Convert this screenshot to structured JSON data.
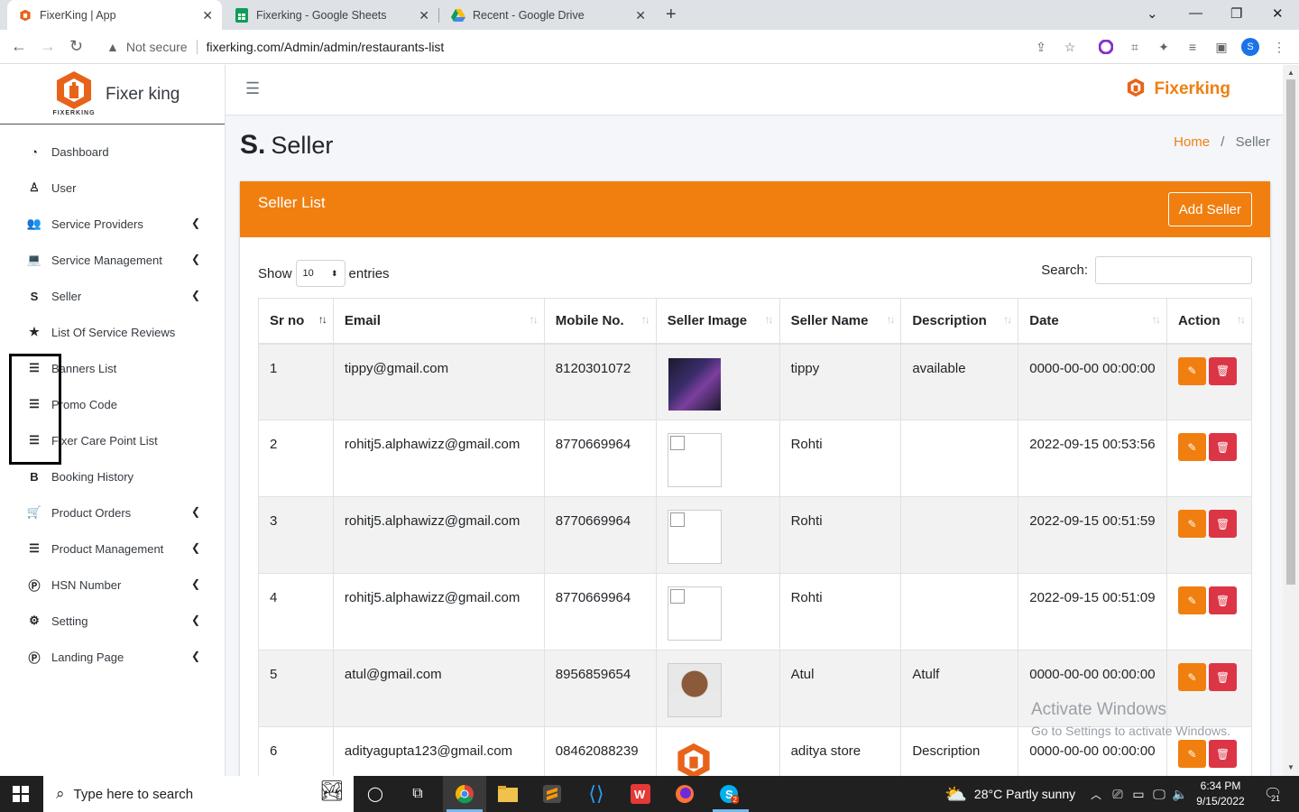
{
  "browser": {
    "tabs": [
      {
        "title": "FixerKing | App"
      },
      {
        "title": "Fixerking - Google Sheets"
      },
      {
        "title": "Recent - Google Drive"
      }
    ],
    "security": "Not secure",
    "url": "fixerking.com/Admin/admin/restaurants-list",
    "profile_initial": "S"
  },
  "sidebar": {
    "brand": "Fixer king",
    "logo_caption": "FIXERKING",
    "items": [
      {
        "label": "Dashboard",
        "icon": "dashboard-icon",
        "glyph": "◔",
        "has_sub": false
      },
      {
        "label": "User",
        "icon": "user-icon",
        "glyph": "♙",
        "has_sub": false
      },
      {
        "label": "Service Providers",
        "icon": "users-icon",
        "glyph": "👥",
        "has_sub": true
      },
      {
        "label": "Service Management",
        "icon": "laptop-icon",
        "glyph": "💻",
        "has_sub": true
      },
      {
        "label": "Seller",
        "icon": "seller-s-icon",
        "glyph": "S",
        "has_sub": true
      },
      {
        "label": "List Of Service Reviews",
        "icon": "star-icon",
        "glyph": "★",
        "has_sub": false
      },
      {
        "label": "Banners List",
        "icon": "list-icon",
        "glyph": "☰",
        "has_sub": false
      },
      {
        "label": "Promo Code",
        "icon": "list-icon",
        "glyph": "☰",
        "has_sub": false
      },
      {
        "label": "Fixer Care Point List",
        "icon": "list-icon",
        "glyph": "☰",
        "has_sub": false
      },
      {
        "label": "Booking History",
        "icon": "bold-b-icon",
        "glyph": "B",
        "has_sub": false
      },
      {
        "label": "Product Orders",
        "icon": "cart-icon",
        "glyph": "🛒",
        "has_sub": true
      },
      {
        "label": "Product Management",
        "icon": "list-icon",
        "glyph": "☰",
        "has_sub": true
      },
      {
        "label": "HSN Number",
        "icon": "p-circle-icon",
        "glyph": "Ⓟ",
        "has_sub": true
      },
      {
        "label": "Setting",
        "icon": "gears-icon",
        "glyph": "⚙",
        "has_sub": true
      },
      {
        "label": "Landing Page",
        "icon": "p-circle-icon",
        "glyph": "Ⓟ",
        "has_sub": true
      }
    ]
  },
  "topnav": {
    "brand": "Fixerking"
  },
  "page": {
    "icon_glyph": "S.",
    "title": "Seller",
    "breadcrumb_home": "Home",
    "breadcrumb_sep": "/",
    "breadcrumb_current": "Seller"
  },
  "card": {
    "title": "Seller List",
    "add_button": "Add Seller",
    "show_label": "Show",
    "entries_value": "10",
    "entries_label": "entries",
    "search_label": "Search:"
  },
  "table": {
    "columns": [
      "Sr no",
      "Email",
      "Mobile No.",
      "Seller Image",
      "Seller Name",
      "Description",
      "Date",
      "Action"
    ],
    "rows": [
      {
        "sr": "1",
        "email": "tippy@gmail.com",
        "mobile": "8120301072",
        "image": "phone",
        "name": "tippy",
        "desc": "available",
        "date": "0000-00-00 00:00:00"
      },
      {
        "sr": "2",
        "email": "rohitj5.alphawizz@gmail.com",
        "mobile": "8770669964",
        "image": "broken",
        "name": "Rohti",
        "desc": "",
        "date": "2022-09-15 00:53:56"
      },
      {
        "sr": "3",
        "email": "rohitj5.alphawizz@gmail.com",
        "mobile": "8770669964",
        "image": "broken",
        "name": "Rohti",
        "desc": "",
        "date": "2022-09-15 00:51:59"
      },
      {
        "sr": "4",
        "email": "rohitj5.alphawizz@gmail.com",
        "mobile": "8770669964",
        "image": "broken",
        "name": "Rohti",
        "desc": "",
        "date": "2022-09-15 00:51:09"
      },
      {
        "sr": "5",
        "email": "atul@gmail.com",
        "mobile": "8956859654",
        "image": "person",
        "name": "Atul",
        "desc": "Atulf",
        "date": "0000-00-00 00:00:00"
      },
      {
        "sr": "6",
        "email": "adityagupta123@gmail.com",
        "mobile": "08462088239",
        "image": "logo",
        "name": "aditya store",
        "desc": "Description",
        "date": "0000-00-00 00:00:00"
      }
    ]
  },
  "watermark": {
    "line1": "Activate Windows",
    "line2": "Go to Settings to activate Windows."
  },
  "taskbar": {
    "search_placeholder": "Type here to search",
    "weather": "28°C  Partly sunny",
    "time": "6:34 PM",
    "date": "9/15/2022",
    "notification_count": "21"
  },
  "colors": {
    "accent": "#f07f10",
    "danger": "#dc3545"
  }
}
